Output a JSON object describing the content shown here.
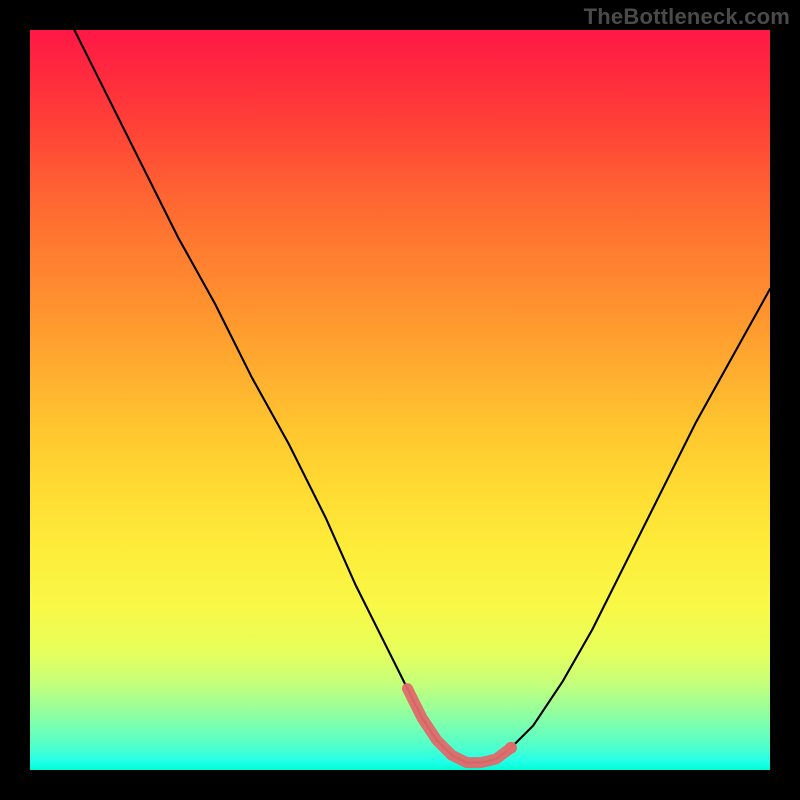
{
  "watermark": "TheBottleneck.com",
  "chart_data": {
    "type": "line",
    "title": "",
    "xlabel": "",
    "ylabel": "",
    "xlim": [
      0,
      100
    ],
    "ylim": [
      0,
      100
    ],
    "grid": false,
    "series": [
      {
        "name": "bottleneck-curve",
        "x": [
          6,
          10,
          15,
          20,
          25,
          30,
          35,
          40,
          44,
          48,
          51,
          53,
          55,
          57,
          59,
          61,
          63,
          65,
          68,
          72,
          76,
          80,
          85,
          90,
          95,
          100
        ],
        "y": [
          100,
          92,
          82,
          72,
          63,
          53,
          44,
          34,
          25,
          17,
          11,
          7,
          4,
          2,
          1,
          1,
          1.5,
          3,
          6,
          12,
          19,
          27,
          37,
          47,
          56,
          65
        ]
      }
    ],
    "highlight": {
      "name": "optimal-range",
      "x": [
        51,
        53,
        55,
        57,
        59,
        61,
        63,
        65
      ],
      "y": [
        11,
        7,
        4,
        2,
        1,
        1,
        1.5,
        3
      ]
    },
    "colors": {
      "gradient_top": "#ff1846",
      "gradient_bottom": "#00ffd0",
      "curve": "#000000",
      "highlight": "#e06a6a",
      "background": "#000000"
    }
  }
}
